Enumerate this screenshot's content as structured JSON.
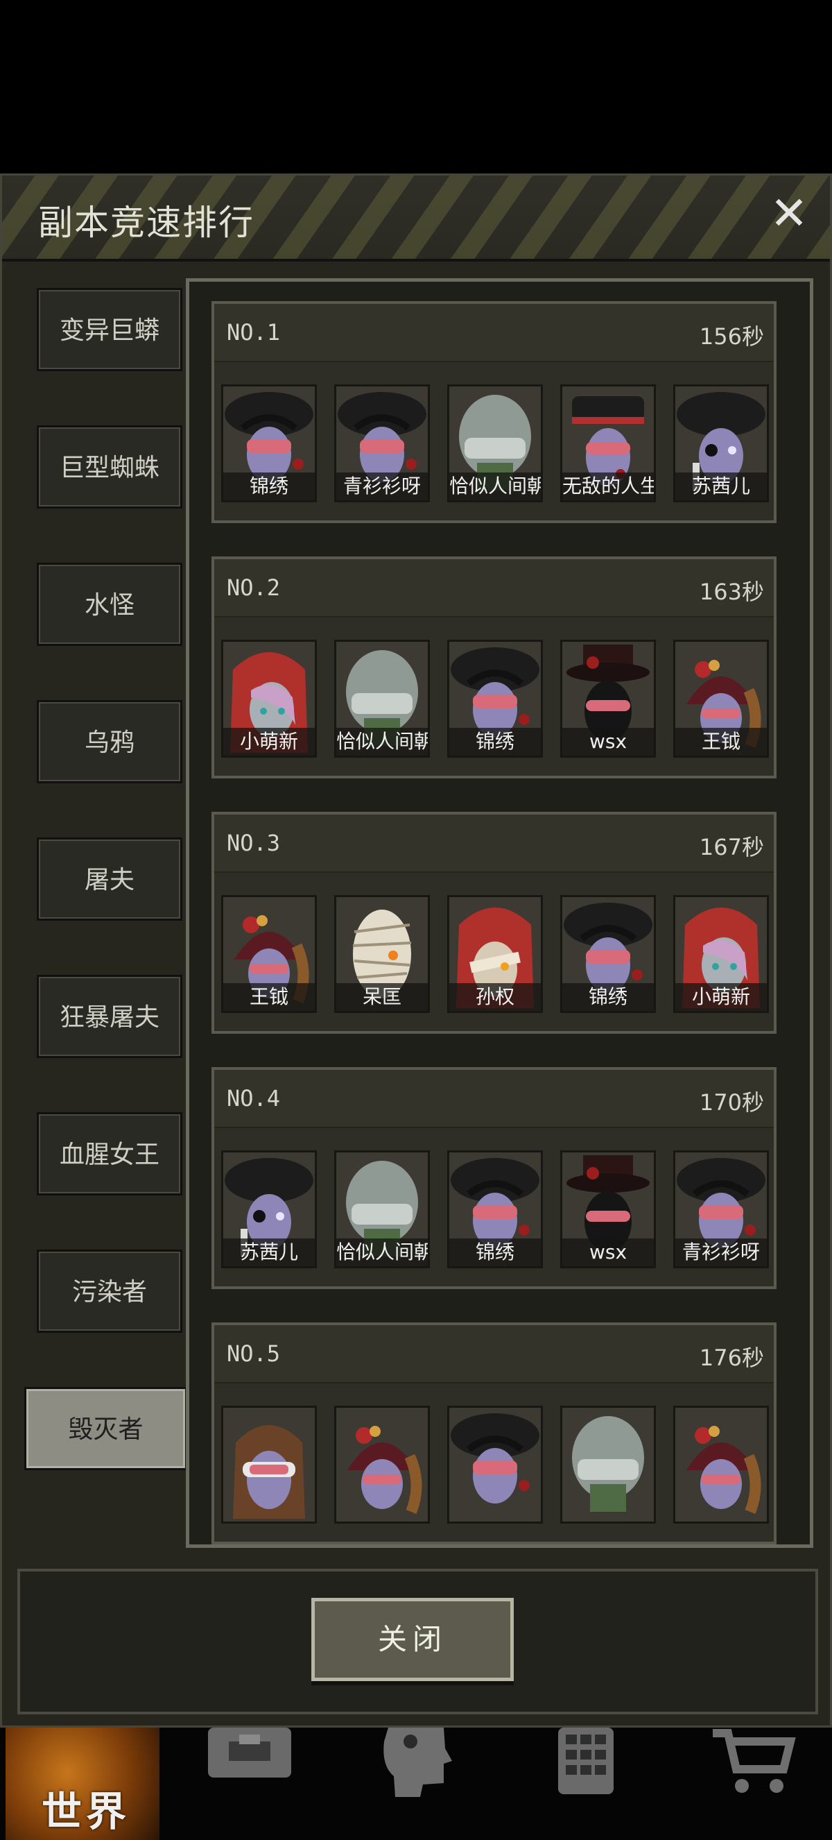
{
  "dialog": {
    "title": "副本竞速排行",
    "close_symbol": "✕"
  },
  "sidebar": {
    "items": [
      {
        "label": "变异巨蟒",
        "active": false
      },
      {
        "label": "巨型蜘蛛",
        "active": false
      },
      {
        "label": "水怪",
        "active": false
      },
      {
        "label": "乌鸦",
        "active": false
      },
      {
        "label": "屠夫",
        "active": false
      },
      {
        "label": "狂暴屠夫",
        "active": false
      },
      {
        "label": "血腥女王",
        "active": false
      },
      {
        "label": "污染者",
        "active": false
      },
      {
        "label": "毁灭者",
        "active": true
      }
    ]
  },
  "rankings": [
    {
      "rank": "NO.1",
      "time": "156秒",
      "players": [
        {
          "name": "锦绣",
          "avatar": "pirate-hat-goggles"
        },
        {
          "name": "青衫衫呀",
          "avatar": "pirate-hat-goggles"
        },
        {
          "name": "恰似人间朝",
          "avatar": "helmet-visor"
        },
        {
          "name": "无敌的人生",
          "avatar": "officer-cap"
        },
        {
          "name": "苏茜儿",
          "avatar": "pirate-hat-eyepatch"
        }
      ]
    },
    {
      "rank": "NO.2",
      "time": "163秒",
      "players": [
        {
          "name": "小萌新",
          "avatar": "red-hood"
        },
        {
          "name": "恰似人间朝",
          "avatar": "helmet-visor"
        },
        {
          "name": "锦绣",
          "avatar": "pirate-hat-goggles"
        },
        {
          "name": "wsx",
          "avatar": "top-hat-mask"
        },
        {
          "name": "王钺",
          "avatar": "rose-hat"
        }
      ]
    },
    {
      "rank": "NO.3",
      "time": "167秒",
      "players": [
        {
          "name": "王钺",
          "avatar": "rose-hat"
        },
        {
          "name": "呆匡",
          "avatar": "bandaged-head"
        },
        {
          "name": "孙权",
          "avatar": "red-hood-bandage"
        },
        {
          "name": "锦绣",
          "avatar": "pirate-hat-goggles"
        },
        {
          "name": "小萌新",
          "avatar": "red-hood"
        }
      ]
    },
    {
      "rank": "NO.4",
      "time": "170秒",
      "players": [
        {
          "name": "苏茜儿",
          "avatar": "pirate-hat-eyepatch"
        },
        {
          "name": "恰似人间朝",
          "avatar": "helmet-visor"
        },
        {
          "name": "锦绣",
          "avatar": "pirate-hat-goggles"
        },
        {
          "name": "wsx",
          "avatar": "top-hat-mask"
        },
        {
          "name": "青衫衫呀",
          "avatar": "pirate-hat-goggles"
        }
      ]
    },
    {
      "rank": "NO.5",
      "time": "176秒",
      "players": [
        {
          "name": "",
          "avatar": "brown-hair-goggles"
        },
        {
          "name": "",
          "avatar": "rose-hat"
        },
        {
          "name": "",
          "avatar": "pirate-hat-goggles"
        },
        {
          "name": "",
          "avatar": "helmet-visor"
        },
        {
          "name": "",
          "avatar": "rose-hat"
        }
      ]
    }
  ],
  "footer": {
    "close_button_label": "关闭"
  },
  "bottom_nav": {
    "items": [
      {
        "label": "世界",
        "icon": "globe-icon"
      },
      {
        "label": "",
        "icon": "backpack-icon"
      },
      {
        "label": "",
        "icon": "head-profile-icon"
      },
      {
        "label": "",
        "icon": "phone-keypad-icon"
      },
      {
        "label": "",
        "icon": "shopping-cart-icon"
      }
    ]
  },
  "colors": {
    "panel_bg": "#2e2e27",
    "border": "#5a5a4f",
    "active_tab": "#8d8d84",
    "world_nav": "#c7761b"
  }
}
